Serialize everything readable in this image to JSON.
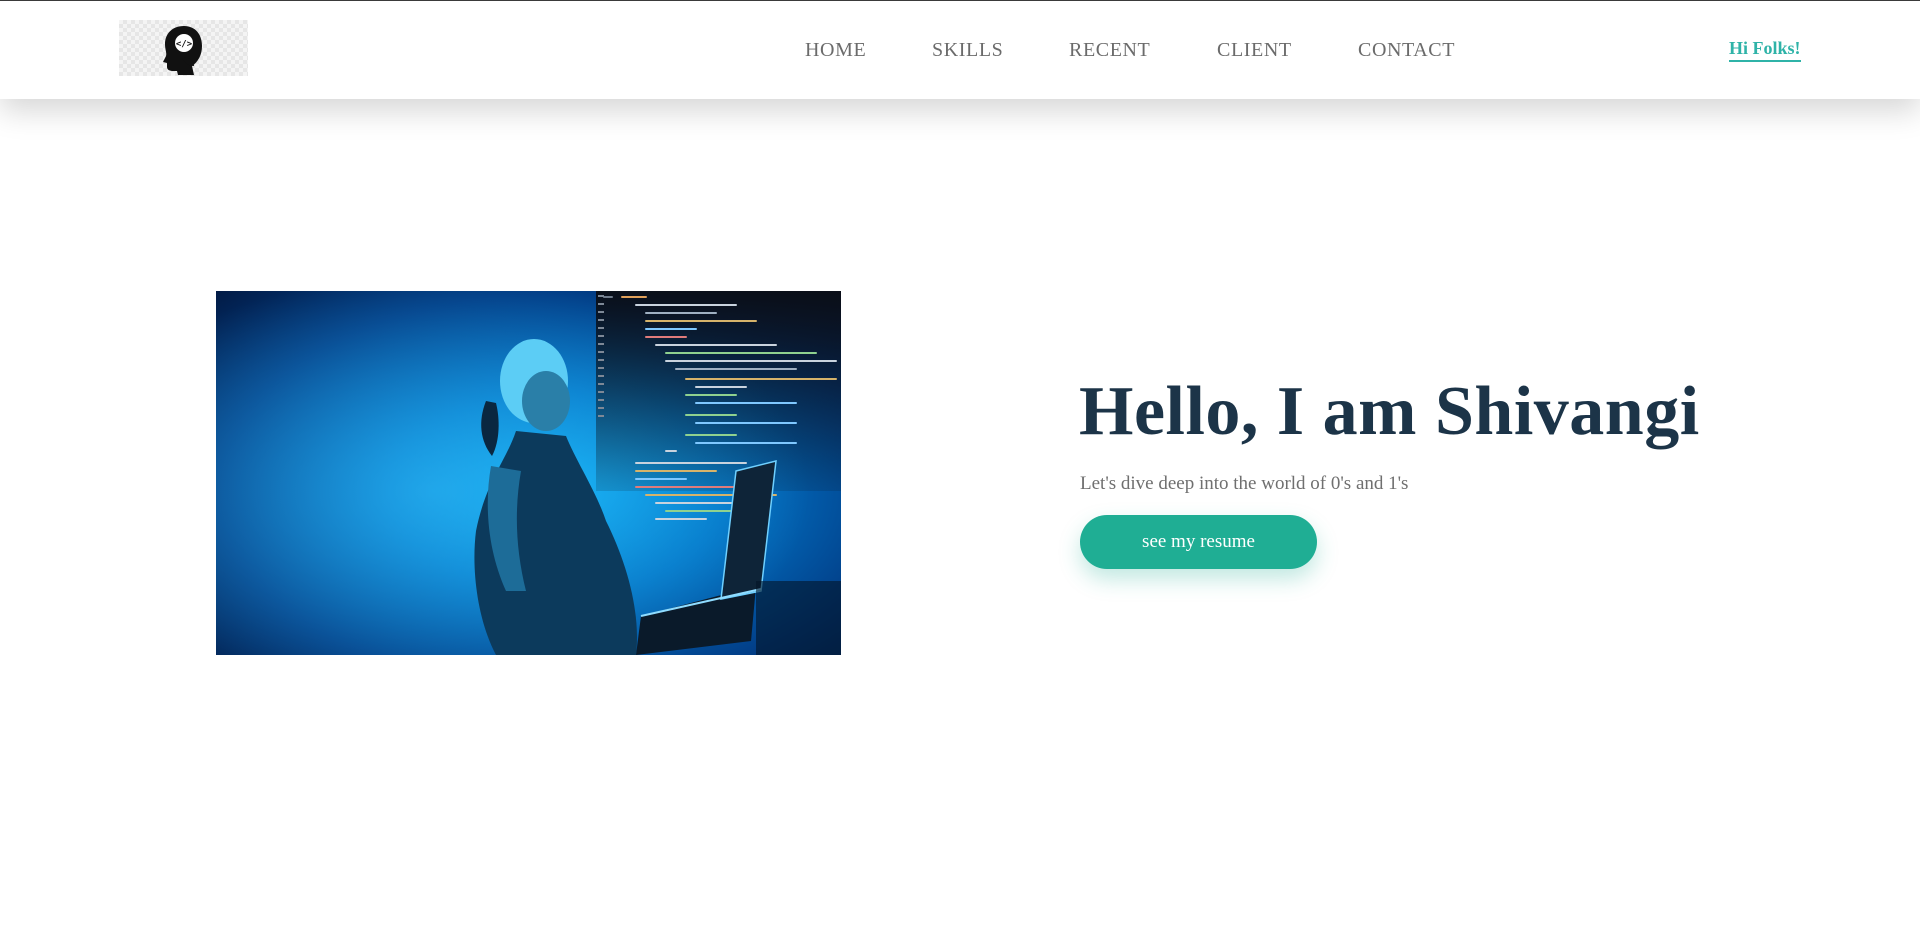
{
  "header": {
    "logo": {
      "icon": "head-code-icon",
      "alt": "logo"
    },
    "nav": [
      {
        "label": "HOME"
      },
      {
        "label": "SKILLS"
      },
      {
        "label": "RECENT"
      },
      {
        "label": "CLIENT"
      },
      {
        "label": "CONTACT"
      }
    ],
    "greeting": "Hi Folks!"
  },
  "hero": {
    "title": "Hello, I am Shivangi",
    "subtitle": "Let's dive deep into the world of 0's and 1's",
    "button_label": "see my resume",
    "image": {
      "icon": "coder-photo"
    }
  },
  "colors": {
    "accent": "#1fae94",
    "link": "#2fb3a8",
    "title": "#1c3448",
    "nav_text": "#6b6b6b",
    "body_text": "#6f6f6f"
  }
}
